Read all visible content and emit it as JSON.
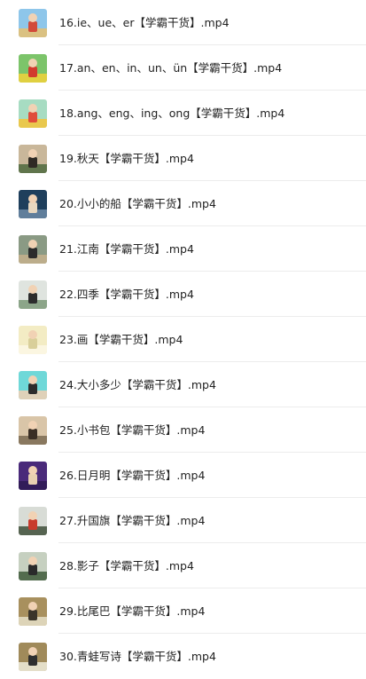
{
  "files": [
    {
      "name": "16.ie、ue、er【学霸干货】.mp4",
      "icon": "video-thumbnail-icon",
      "colors": [
        "#8ec6ea",
        "#e8c070",
        "#d24a3a"
      ]
    },
    {
      "name": "17.an、en、in、un、ün【学霸干货】.mp4",
      "icon": "video-thumbnail-icon",
      "colors": [
        "#7cc46a",
        "#f2d23a",
        "#d23a2e"
      ]
    },
    {
      "name": "18.ang、eng、ing、ong【学霸干货】.mp4",
      "icon": "video-thumbnail-icon",
      "colors": [
        "#a7dcc2",
        "#f4c43a",
        "#e04c3a"
      ]
    },
    {
      "name": "19.秋天【学霸干货】.mp4",
      "icon": "video-thumbnail-icon",
      "colors": [
        "#c9b79a",
        "#4d6a3e",
        "#2f2a24"
      ]
    },
    {
      "name": "20.小小的船【学霸干货】.mp4",
      "icon": "video-thumbnail-icon",
      "colors": [
        "#1f3f5c",
        "#6c8aa6",
        "#e9d8c0"
      ]
    },
    {
      "name": "21.江南【学霸干货】.mp4",
      "icon": "video-thumbnail-icon",
      "colors": [
        "#8a9a84",
        "#c4b08c",
        "#2b2b2b"
      ]
    },
    {
      "name": "22.四季【学霸干货】.mp4",
      "icon": "video-thumbnail-icon",
      "colors": [
        "#dfe4df",
        "#7e9a7a",
        "#2c2c2c"
      ]
    },
    {
      "name": "23.画【学霸干货】.mp4",
      "icon": "video-thumbnail-icon",
      "colors": [
        "#f3ecc4",
        "#fbf8e6",
        "#d9cf9a"
      ]
    },
    {
      "name": "24.大小多少【学霸干货】.mp4",
      "icon": "video-thumbnail-icon",
      "colors": [
        "#6fd8d8",
        "#f3d0b4",
        "#2c2c2c"
      ]
    },
    {
      "name": "25.小书包【学霸干货】.mp4",
      "icon": "video-thumbnail-icon",
      "colors": [
        "#d9c5a8",
        "#7a6a52",
        "#3a2e24"
      ]
    },
    {
      "name": "26.日月明【学霸干货】.mp4",
      "icon": "video-thumbnail-icon",
      "colors": [
        "#4a2a7a",
        "#2e1a54",
        "#e8d0b0"
      ]
    },
    {
      "name": "27.升国旗【学霸干货】.mp4",
      "icon": "video-thumbnail-icon",
      "colors": [
        "#d8dcd6",
        "#3f4f3a",
        "#c83a2c"
      ]
    },
    {
      "name": "28.影子【学霸干货】.mp4",
      "icon": "video-thumbnail-icon",
      "colors": [
        "#c6d0c0",
        "#3e5a3a",
        "#2a2a2a"
      ]
    },
    {
      "name": "29.比尾巴【学霸干货】.mp4",
      "icon": "video-thumbnail-icon",
      "colors": [
        "#a8905e",
        "#e6e0c8",
        "#3a342a"
      ]
    },
    {
      "name": "30.青蛙写诗【学霸干货】.mp4",
      "icon": "video-thumbnail-icon",
      "colors": [
        "#a08a5a",
        "#f0ecdc",
        "#2e2e2e"
      ]
    }
  ]
}
